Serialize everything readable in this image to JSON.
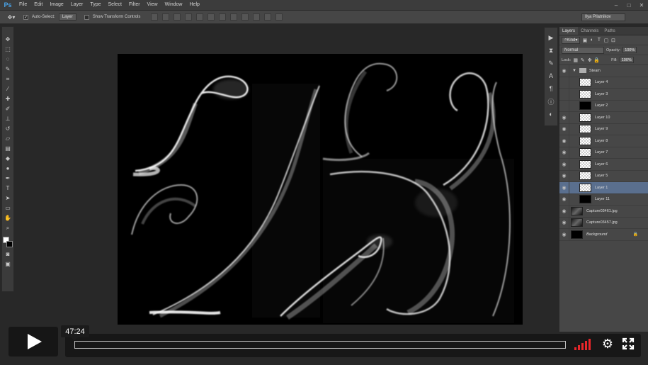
{
  "app": {
    "logo": "Ps"
  },
  "menu": [
    "File",
    "Edit",
    "Image",
    "Layer",
    "Type",
    "Select",
    "Filter",
    "View",
    "Window",
    "Help"
  ],
  "options_bar": {
    "auto_select_label": "Auto-Select:",
    "auto_select_value": "Layer",
    "show_transform_label": "Show Transform Controls",
    "workspace": "Ilya Pilatnikov"
  },
  "layers_panel": {
    "tabs": [
      "Layers",
      "Channels",
      "Paths"
    ],
    "filter_kind": "Kind",
    "blend_mode": "Normal",
    "opacity_label": "Opacity:",
    "opacity_value": "100%",
    "lock_label": "Lock:",
    "fill_label": "Fill:",
    "fill_value": "100%",
    "group_name": "Steam",
    "layers": [
      {
        "name": "Layer 4",
        "thumb": "transparent",
        "visible": false
      },
      {
        "name": "Layer 3",
        "thumb": "transparent",
        "visible": false
      },
      {
        "name": "Layer 2",
        "thumb": "dark",
        "visible": false
      },
      {
        "name": "Layer 10",
        "thumb": "transparent",
        "visible": true
      },
      {
        "name": "Layer 9",
        "thumb": "transparent",
        "visible": true
      },
      {
        "name": "Layer 8",
        "thumb": "transparent",
        "visible": true
      },
      {
        "name": "Layer 7",
        "thumb": "transparent",
        "visible": true
      },
      {
        "name": "Layer 6",
        "thumb": "transparent",
        "visible": true
      },
      {
        "name": "Layer 5",
        "thumb": "transparent",
        "visible": true
      },
      {
        "name": "Layer 1",
        "thumb": "transparent",
        "visible": true,
        "selected": true
      },
      {
        "name": "Layer 11",
        "thumb": "dark",
        "visible": true
      }
    ],
    "outer_layers": [
      {
        "name": "Capture03461.jpg",
        "thumb": "photo"
      },
      {
        "name": "Capture03457.jpg",
        "thumb": "photo"
      },
      {
        "name": "Background",
        "thumb": "dark",
        "italic": true,
        "locked": true
      }
    ]
  },
  "player": {
    "time": "47:24",
    "progress": 0.0,
    "volume_bars": 5
  },
  "colors": {
    "accent_selected": "#5a6f8e",
    "volume": "#e8262a",
    "ps_blue": "#4aa3e8"
  }
}
